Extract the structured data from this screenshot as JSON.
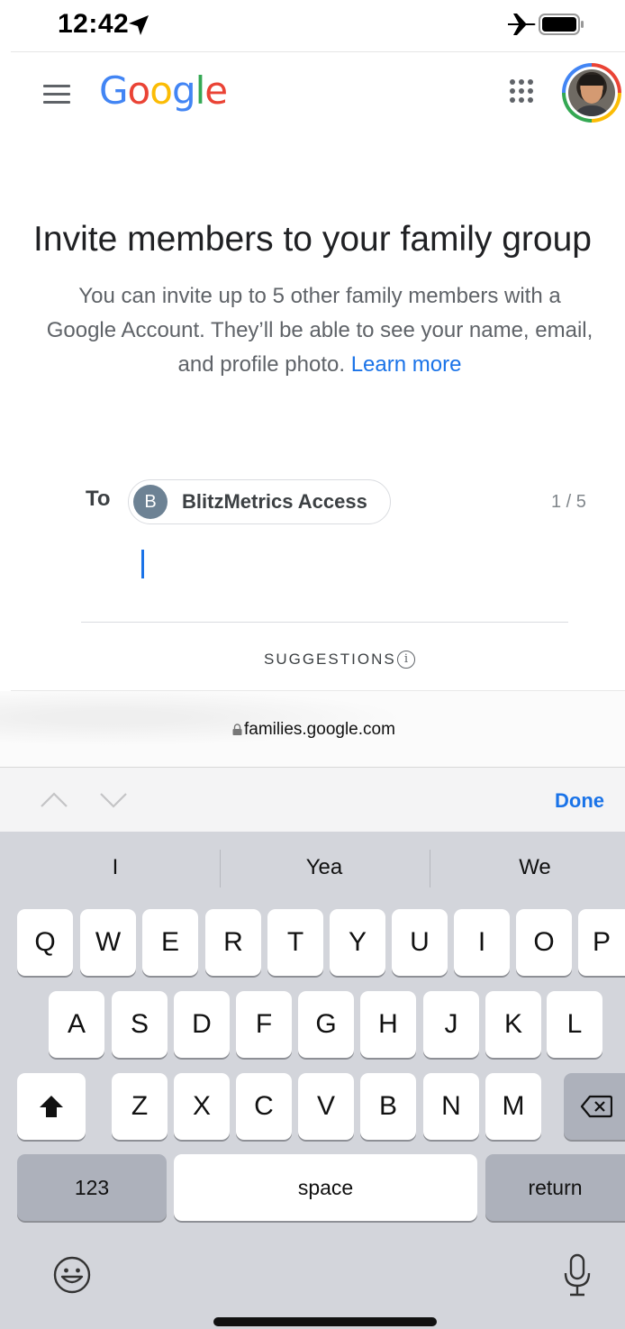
{
  "status_bar": {
    "time": "12:42",
    "icons": [
      "location-arrow-icon",
      "airplane-icon",
      "battery-icon"
    ]
  },
  "header": {
    "logo_letters": [
      {
        "char": "G",
        "color": "#4285f4"
      },
      {
        "char": "o",
        "color": "#ea4335"
      },
      {
        "char": "o",
        "color": "#fbbc05"
      },
      {
        "char": "g",
        "color": "#4285f4"
      },
      {
        "char": "l",
        "color": "#34a853"
      },
      {
        "char": "e",
        "color": "#ea4335"
      }
    ],
    "icons": [
      "menu-icon",
      "apps-grid-icon",
      "account-avatar"
    ]
  },
  "main": {
    "title": "Invite members to your family group",
    "description": "You can invite up to 5 other family members with a Google Account. They’ll be able to see your name, email, and profile photo.",
    "learn_more": "Learn more",
    "to_label": "To",
    "recipient": {
      "initial": "B",
      "name": "BlitzMetrics Access"
    },
    "counter": "1 / 5",
    "suggestions_label": "SUGGESTIONS"
  },
  "browser": {
    "url": "families.google.com"
  },
  "keyboard_toolbar": {
    "done_label": "Done"
  },
  "keyboard": {
    "predictions": [
      "I",
      "Yea",
      "We"
    ],
    "row1": [
      "Q",
      "W",
      "E",
      "R",
      "T",
      "Y",
      "U",
      "I",
      "O",
      "P"
    ],
    "row2": [
      "A",
      "S",
      "D",
      "F",
      "G",
      "H",
      "J",
      "K",
      "L"
    ],
    "row3": [
      "Z",
      "X",
      "C",
      "V",
      "B",
      "N",
      "M"
    ],
    "numbers_label": "123",
    "space_label": "space",
    "return_label": "return"
  },
  "colors": {
    "accent": "#1a73e8",
    "keyboard_bg": "#d3d5db",
    "chip_avatar": "#6d8294"
  }
}
